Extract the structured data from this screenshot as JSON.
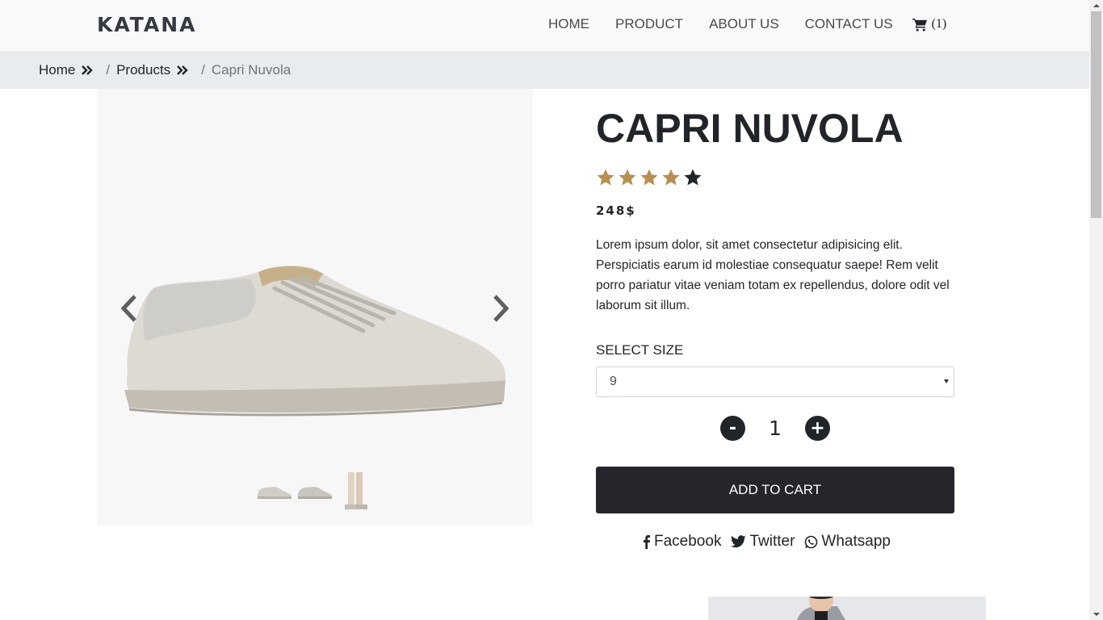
{
  "navbar": {
    "brand": "KATANA",
    "links": [
      "HOME",
      "PRODUCT",
      "ABOUT US",
      "CONTACT US"
    ],
    "cart_count": "(1)"
  },
  "breadcrumb": {
    "items": [
      "Home",
      "Products"
    ],
    "separator": "/",
    "active": "Capri Nuvola"
  },
  "product": {
    "title": "CAPRI NUVOLA",
    "rating": 4,
    "rating_max": 5,
    "price": "248$",
    "description": "Lorem ipsum dolor, sit amet consectetur adipisicing elit. Perspiciatis earum id molestiae consequatur saepe! Rem velit porro pariatur vitae veniam totam ex repellendus, dolore odit vel laborum sit illum.",
    "size_label": "SELECT SIZE",
    "size_value": "9",
    "qty_minus": "-",
    "qty_value": "1",
    "qty_plus": "+",
    "add_to_cart": "ADD TO CART",
    "share": [
      "Facebook",
      "Twitter",
      "Whatsapp"
    ]
  },
  "colors": {
    "star_filled": "#b88f53",
    "star_empty": "#212529",
    "button_dark": "#25262b",
    "navbar_bg": "#f8f9fa",
    "breadcrumb_bg": "#e9ecef"
  },
  "icons": {
    "cart": "shopping-cart-icon",
    "breadcrumb_chevron": "double-chevron-right-icon",
    "prev": "chevron-left-icon",
    "next": "chevron-right-icon",
    "facebook": "facebook-icon",
    "twitter": "twitter-icon",
    "whatsapp": "whatsapp-icon"
  }
}
